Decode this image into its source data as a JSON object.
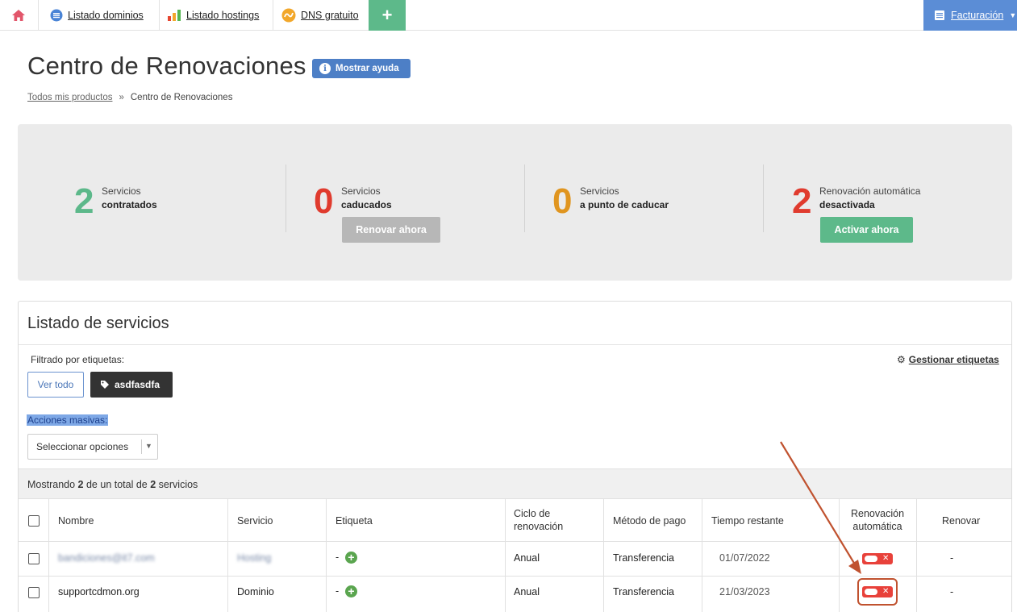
{
  "nav": {
    "domains_label": "Listado dominios",
    "hostings_label": "Listado hostings",
    "dns_label": "DNS gratuito",
    "plus_label": "+",
    "billing_label": "Facturación"
  },
  "header": {
    "title": "Centro de Renovaciones",
    "help_button": "Mostrar ayuda"
  },
  "breadcrumb": {
    "parent": "Todos mis productos",
    "separator": "»",
    "current": "Centro de Renovaciones"
  },
  "stats": [
    {
      "number": "2",
      "line1": "Servicios",
      "line2": "contratados",
      "color": "#5cb88a"
    },
    {
      "number": "0",
      "line1": "Servicios",
      "line2": "caducados",
      "color": "#e03b2e",
      "button": "Renovar ahora"
    },
    {
      "number": "0",
      "line1": "Servicios",
      "line2": "a punto de caducar",
      "color": "#e0951f"
    },
    {
      "number": "2",
      "line1": "Renovación automática",
      "line2": "desactivada",
      "color": "#e03b2e",
      "button": "Activar ahora"
    }
  ],
  "services": {
    "title": "Listado de servicios",
    "filter_label": "Filtrado por etiquetas:",
    "manage_tags": "Gestionar etiquetas",
    "btn_all": "Ver todo",
    "tag": "asdfasdfa",
    "mass_actions": "Acciones masivas:",
    "select_placeholder": "Seleccionar opciones",
    "count_prefix": "Mostrando",
    "count_shown": "2",
    "count_mid": "de un total de",
    "count_total": "2",
    "count_suffix": "servicios"
  },
  "table": {
    "headers": {
      "name": "Nombre",
      "service": "Servicio",
      "tag": "Etiqueta",
      "cycle": [
        "Ciclo de",
        "renovación"
      ],
      "payment": "Método de pago",
      "remaining": "Tiempo restante",
      "auto": [
        "Renovación",
        "automática"
      ],
      "renew": "Renovar"
    },
    "rows": [
      {
        "name": "bandiciones@it7.com",
        "service": "Hosting",
        "tag": "-",
        "cycle": "Anual",
        "payment": "Transferencia",
        "remaining": "01/07/2022",
        "renew": "-"
      },
      {
        "name": "supportcdmon.org",
        "service": "Dominio",
        "tag": "-",
        "cycle": "Anual",
        "payment": "Transferencia",
        "remaining": "21/03/2023",
        "renew": "-"
      }
    ]
  },
  "colors": {
    "accent_green": "#5db98a",
    "accent_blue": "#5b8dd6",
    "toggle_off": "#e8413a",
    "annotation": "#c0522f"
  }
}
